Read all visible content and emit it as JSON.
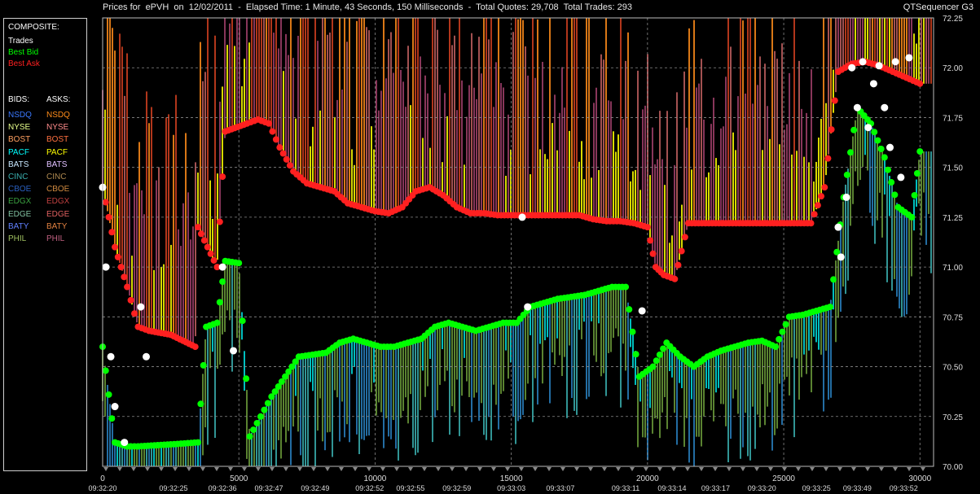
{
  "header": {
    "title": "Prices for  ePVH  on  12/02/2011  -  Elapsed Time: 1 Minute, 43 Seconds, 150 Milliseconds  -  Total Quotes: 29,708  Total Trades: 293",
    "app_name": "QTSequencer G3"
  },
  "legend": {
    "composite_heading": "COMPOSITE:",
    "composite": [
      {
        "label": "Trades",
        "color": "#ffffff"
      },
      {
        "label": "Best Bid",
        "color": "#00ff00"
      },
      {
        "label": "Best Ask",
        "color": "#ff2020"
      }
    ],
    "bids_heading": "BIDS:",
    "asks_heading": "ASKS:",
    "exchanges": [
      {
        "bid": "NSDQ",
        "ask": "NSDQ",
        "bid_color": "#3a78ff",
        "ask_color": "#ff8c1a"
      },
      {
        "bid": "NYSE",
        "ask": "NYSE",
        "bid_color": "#e8ff8c",
        "ask_color": "#ff8c8c"
      },
      {
        "bid": "BOST",
        "ask": "BOST",
        "bid_color": "#ffa060",
        "ask_color": "#ff7040"
      },
      {
        "bid": "PACF",
        "ask": "PACF",
        "bid_color": "#00ffff",
        "ask_color": "#ffff00"
      },
      {
        "bid": "BATS",
        "ask": "BATS",
        "bid_color": "#c8e8ff",
        "ask_color": "#e0c0ff"
      },
      {
        "bid": "CINC",
        "ask": "CINC",
        "bid_color": "#3ab0b0",
        "ask_color": "#b08a50"
      },
      {
        "bid": "CBOE",
        "ask": "CBOE",
        "bid_color": "#2a60c0",
        "ask_color": "#d08a40"
      },
      {
        "bid": "EDGX",
        "ask": "EDGX",
        "bid_color": "#3aa040",
        "ask_color": "#c04040"
      },
      {
        "bid": "EDGE",
        "ask": "EDGE",
        "bid_color": "#80c0a0",
        "ask_color": "#e06060"
      },
      {
        "bid": "BATY",
        "ask": "BATY",
        "bid_color": "#6080ff",
        "ask_color": "#e08040"
      },
      {
        "bid": "PHIL",
        "ask": "PHIL",
        "bid_color": "#a0c060",
        "ask_color": "#c06080"
      }
    ]
  },
  "chart_data": {
    "type": "scatter",
    "title": "Prices for  ePVH  on  12/02/2011",
    "xlim": [
      0,
      30500
    ],
    "ylim": [
      70.0,
      72.25
    ],
    "x_ticks": [
      0,
      5000,
      10000,
      15000,
      20000,
      25000,
      30000
    ],
    "y_ticks": [
      70.0,
      70.25,
      70.5,
      70.75,
      71.0,
      71.25,
      71.5,
      71.75,
      72.0,
      72.25
    ],
    "y_tick_labels": [
      "70.00",
      "70.25",
      "70.50",
      "70.75",
      "71.00",
      "71.25",
      "71.50",
      "71.75",
      "72.00",
      "72.25"
    ],
    "time_labels": [
      "09:32:20",
      "09:32:25",
      "09:32:36",
      "09:32:47",
      "09:32:49",
      "09:32:52",
      "09:32:55",
      "09:32:59",
      "09:33:03",
      "09:33:07",
      "09:33:11",
      "09:33:14",
      "09:33:17",
      "09:33:20",
      "09:33:25",
      "09:33:49",
      "09:33:52"
    ],
    "time_label_x": [
      0,
      2600,
      4400,
      6100,
      7800,
      9800,
      11300,
      13000,
      15000,
      16800,
      19200,
      20900,
      22500,
      24200,
      26200,
      27700,
      29400
    ],
    "grid": true,
    "series": [
      {
        "name": "Best Ask",
        "color": "#ff2020",
        "x": [
          0,
          450,
          900,
          1300,
          1700,
          2500,
          3400,
          3500,
          4200,
          4500,
          5300,
          5700,
          6100,
          6500,
          7000,
          7500,
          8000,
          8500,
          9000,
          9500,
          10000,
          10500,
          11000,
          11500,
          12000,
          12500,
          13000,
          13500,
          14000,
          14500,
          15000,
          15500,
          16000,
          16500,
          17000,
          17500,
          18000,
          18500,
          19000,
          19500,
          20000,
          20300,
          20600,
          21000,
          21500,
          22000,
          22500,
          23000,
          23500,
          24000,
          24500,
          25000,
          25500,
          26000,
          26500,
          27000,
          27500,
          28000,
          28500,
          29000,
          29500,
          30000
        ],
        "y": [
          71.4,
          71.1,
          70.9,
          70.7,
          70.68,
          70.66,
          70.6,
          71.2,
          71.0,
          71.68,
          71.72,
          71.74,
          71.72,
          71.6,
          71.48,
          71.42,
          71.4,
          71.38,
          71.32,
          71.3,
          71.28,
          71.27,
          71.3,
          71.38,
          71.4,
          71.36,
          71.3,
          71.27,
          71.27,
          71.26,
          71.26,
          71.26,
          71.26,
          71.26,
          71.26,
          71.26,
          71.24,
          71.23,
          71.23,
          71.22,
          71.2,
          71.0,
          70.96,
          70.94,
          71.22,
          71.22,
          71.22,
          71.22,
          71.22,
          71.22,
          71.22,
          71.22,
          71.22,
          71.22,
          71.4,
          71.98,
          72.02,
          72.03,
          72.01,
          71.98,
          71.95,
          71.92
        ]
      },
      {
        "name": "Best Bid",
        "color": "#00ff00",
        "x": [
          0,
          450,
          900,
          1300,
          2500,
          3500,
          3800,
          4200,
          4500,
          5000,
          5400,
          5800,
          6200,
          6700,
          7200,
          7700,
          8200,
          8700,
          9200,
          9700,
          10200,
          10700,
          11200,
          11700,
          12200,
          12700,
          13200,
          13700,
          14200,
          14700,
          15200,
          15700,
          16200,
          16700,
          17200,
          17700,
          18200,
          18700,
          19200,
          19700,
          20200,
          20700,
          21200,
          21700,
          22200,
          22700,
          23200,
          23700,
          24200,
          24700,
          25200,
          25700,
          26200,
          26700,
          27200,
          27700,
          28200,
          28700,
          29200,
          29700,
          30000
        ],
        "y": [
          70.6,
          70.12,
          70.1,
          70.1,
          70.11,
          70.12,
          70.7,
          70.72,
          71.03,
          71.02,
          70.15,
          70.25,
          70.35,
          70.45,
          70.55,
          70.56,
          70.57,
          70.62,
          70.64,
          70.62,
          70.6,
          70.6,
          70.62,
          70.64,
          70.7,
          70.72,
          70.7,
          70.68,
          70.7,
          70.72,
          70.72,
          70.8,
          70.82,
          70.84,
          70.85,
          70.86,
          70.88,
          70.9,
          70.9,
          70.45,
          70.5,
          70.62,
          70.55,
          70.5,
          70.55,
          70.58,
          70.6,
          70.62,
          70.63,
          70.6,
          70.75,
          70.76,
          70.78,
          70.8,
          71.35,
          71.8,
          71.72,
          71.55,
          71.3,
          71.25,
          71.58
        ]
      },
      {
        "name": "Trades",
        "color": "#ffffff",
        "x": [
          0,
          120,
          300,
          450,
          800,
          1400,
          1600,
          4400,
          4800,
          15400,
          15600,
          19800,
          27000,
          27100,
          27300,
          27500,
          27700,
          27900,
          28100,
          28300,
          28500,
          28700,
          28900,
          29100,
          29300,
          29600
        ],
        "y": [
          71.4,
          71.0,
          70.55,
          70.3,
          70.12,
          70.8,
          70.55,
          71.0,
          70.58,
          71.25,
          70.8,
          70.78,
          71.2,
          71.05,
          71.35,
          72.0,
          71.8,
          72.03,
          71.7,
          71.92,
          72.01,
          71.8,
          71.6,
          72.03,
          71.45,
          72.05
        ]
      }
    ]
  }
}
